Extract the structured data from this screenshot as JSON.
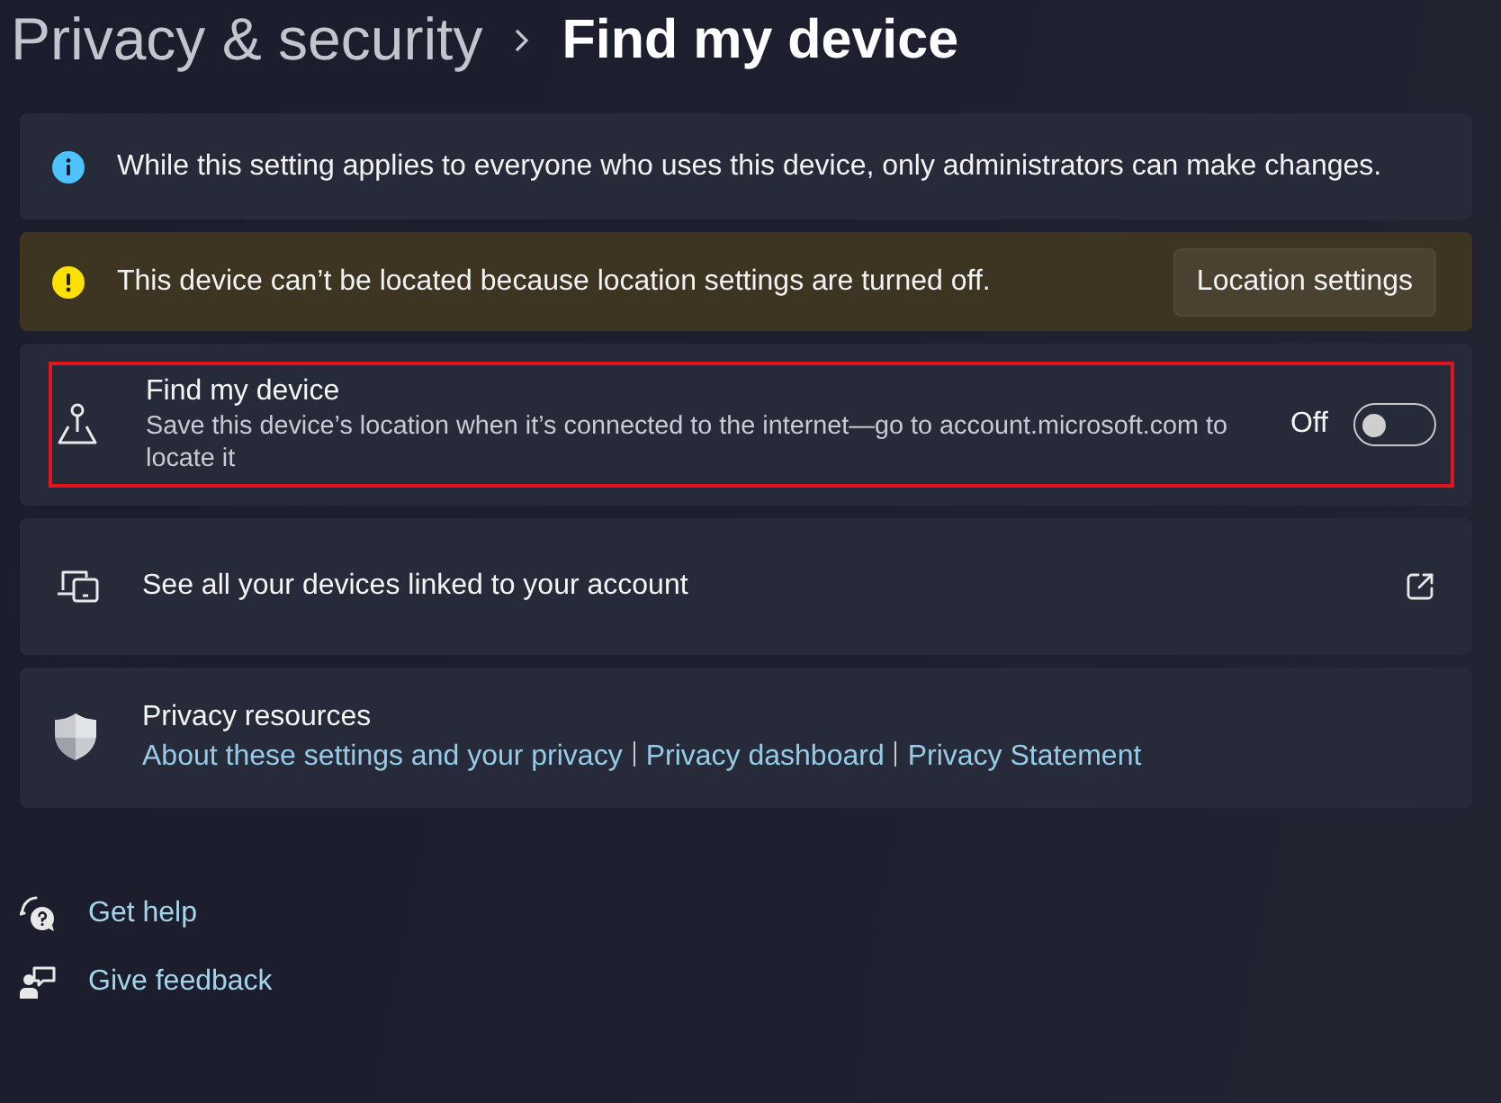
{
  "breadcrumb": {
    "parent": "Privacy & security",
    "current": "Find my device"
  },
  "banners": [
    {
      "kind": "info",
      "text": "While this setting applies to everyone who uses this device, only administrators can make changes."
    },
    {
      "kind": "warning",
      "text": "This device can’t be located because location settings are turned off.",
      "button": "Location settings"
    }
  ],
  "settings": [
    {
      "kind": "toggle",
      "title": "Find my device",
      "description": "Save this device’s location when it’s connected to the internet—go to account.microsoft.com to locate it",
      "state_label": "Off",
      "on": false,
      "highlighted": true
    },
    {
      "kind": "link",
      "title": "See all your devices linked to your account"
    },
    {
      "kind": "resources",
      "title": "Privacy resources",
      "links": [
        "About these settings and your privacy",
        "Privacy dashboard",
        "Privacy Statement"
      ]
    }
  ],
  "help_links": [
    {
      "kind": "help",
      "label": "Get help"
    },
    {
      "kind": "feedback",
      "label": "Give feedback"
    }
  ]
}
